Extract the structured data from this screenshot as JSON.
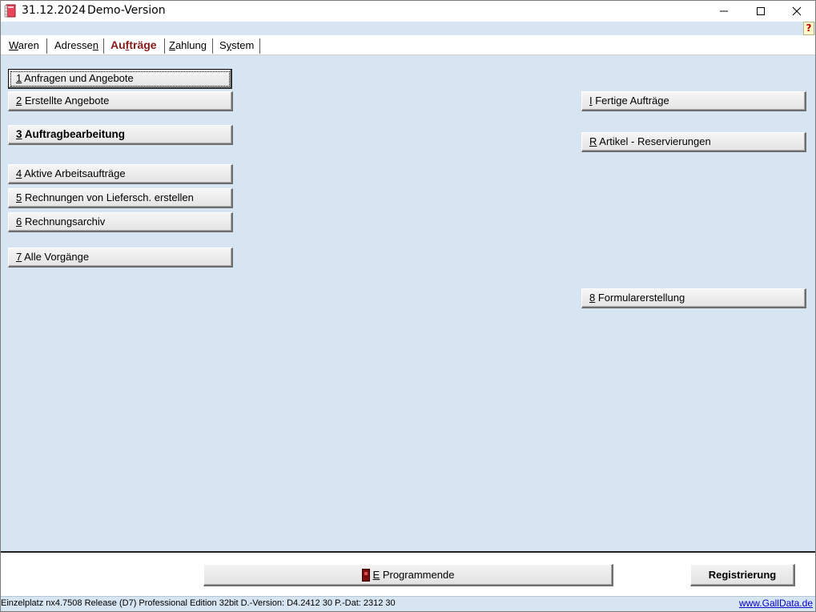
{
  "window": {
    "date": "31.12.2024",
    "title": "Demo-Version",
    "help_label": "?"
  },
  "tabs": [
    {
      "key": "W",
      "rest": "aren"
    },
    {
      "key": "Adresse",
      "rest": "n"
    },
    {
      "key": "Au",
      "mid": "f",
      "rest": "träge"
    },
    {
      "key": "Z",
      "rest": "ahlung"
    },
    {
      "key": "S",
      "mid": "y",
      "rest": "stem"
    }
  ],
  "left_buttons": [
    {
      "key": "1",
      "label": " Anfragen und Angebote"
    },
    {
      "key": "2",
      "label": " Erstellte Angebote"
    },
    {
      "key": "3",
      "label": " Auftragbearbeitung"
    },
    {
      "key": "4",
      "label": " Aktive  Arbeitsaufträge"
    },
    {
      "key": "5",
      "label": " Rechnungen von Liefersch. erstellen"
    },
    {
      "key": "6",
      "label": " Rechnungsarchiv"
    },
    {
      "key": "7",
      "label": " Alle Vorgänge"
    }
  ],
  "right_buttons": [
    {
      "key": "I",
      "label": " Fertige Aufträge"
    },
    {
      "key": "R",
      "label": " Artikel - Reservierungen"
    },
    {
      "key": "8",
      "label": " Formularerstellung"
    }
  ],
  "bottom": {
    "end_key": "E",
    "end_label": " Programmende",
    "register_label": "Registrierung"
  },
  "status": {
    "text": "Einzelplatz nx4.7508 Release (D7) Professional Edition 32bit  D.-Version: D4.2412 30 P.-Dat: 2312 30",
    "link": "www.GallData.de"
  }
}
